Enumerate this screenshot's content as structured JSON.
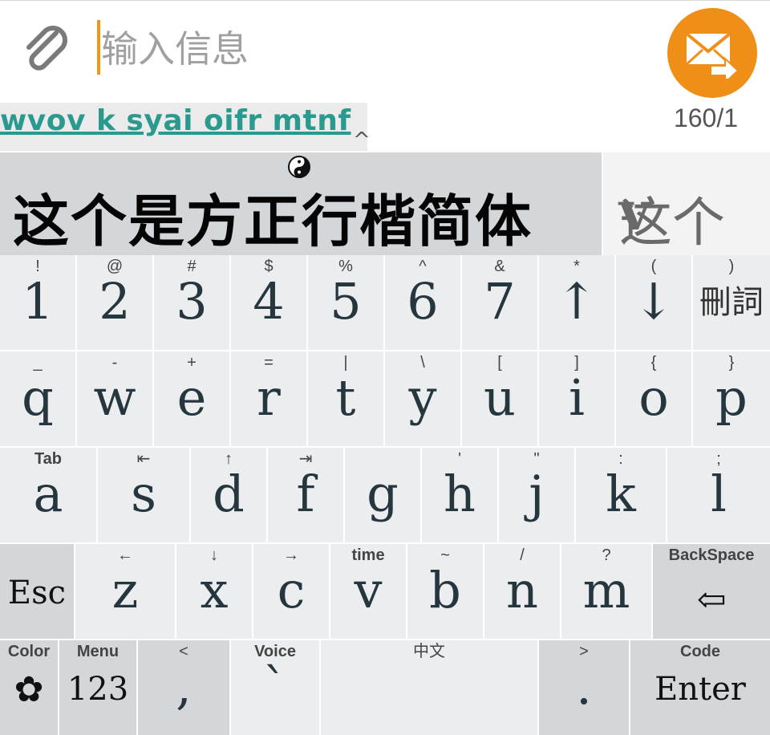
{
  "compose": {
    "placeholder": "输入信息",
    "counter": "160/1",
    "composing": "wvov k syai oifr mtnf",
    "caret_mark": "^"
  },
  "candidates": {
    "main": "这个是方正行楷简体",
    "next": "这个",
    "expand": "v"
  },
  "colors": {
    "accent": "#ef8f17",
    "composing_text": "#2a9a8f",
    "key_bg": "#ebedef",
    "function_key_bg": "#d4d7da"
  },
  "keyboard": {
    "row1": [
      {
        "sub": "!",
        "main": "1"
      },
      {
        "sub": "@",
        "main": "2"
      },
      {
        "sub": "#",
        "main": "3"
      },
      {
        "sub": "$",
        "main": "4"
      },
      {
        "sub": "%",
        "main": "5"
      },
      {
        "sub": "^",
        "main": "6"
      },
      {
        "sub": "&",
        "main": "7"
      },
      {
        "sub": "*",
        "main": "↑"
      },
      {
        "sub": "(",
        "main": "↓"
      },
      {
        "sub": ")",
        "main": "刪詞"
      }
    ],
    "row2": [
      {
        "sub": "_",
        "main": "q"
      },
      {
        "sub": "-",
        "main": "w"
      },
      {
        "sub": "+",
        "main": "e"
      },
      {
        "sub": "=",
        "main": "r"
      },
      {
        "sub": "|",
        "main": "t"
      },
      {
        "sub": "\\",
        "main": "y"
      },
      {
        "sub": "[",
        "main": "u"
      },
      {
        "sub": "]",
        "main": "i"
      },
      {
        "sub": "{",
        "main": "o"
      },
      {
        "sub": "}",
        "main": "p"
      }
    ],
    "row3": [
      {
        "sub": "Tab",
        "main": "a"
      },
      {
        "sub": "⇤",
        "main": "s"
      },
      {
        "sub": "↑",
        "main": "d"
      },
      {
        "sub": "⇥",
        "main": "f"
      },
      {
        "sub": "",
        "main": "g"
      },
      {
        "sub": "'",
        "main": "h"
      },
      {
        "sub": "\"",
        "main": "j"
      },
      {
        "sub": ":",
        "main": "k"
      },
      {
        "sub": ";",
        "main": "l"
      }
    ],
    "row4": [
      {
        "sub": "",
        "main": "Esc"
      },
      {
        "sub": "←",
        "main": "z"
      },
      {
        "sub": "↓",
        "main": "x"
      },
      {
        "sub": "→",
        "main": "c"
      },
      {
        "sub": "time",
        "main": "v"
      },
      {
        "sub": "~",
        "main": "b"
      },
      {
        "sub": "/",
        "main": "n"
      },
      {
        "sub": "?",
        "main": "m"
      },
      {
        "sub": "BackSpace",
        "main": "⇦"
      }
    ],
    "row5": [
      {
        "sub": "Color",
        "main": "✿"
      },
      {
        "sub": "Menu",
        "main": "123"
      },
      {
        "sub": "<",
        "main": ","
      },
      {
        "sub": "Voice",
        "main": "`"
      },
      {
        "sub": "中文",
        "main": ""
      },
      {
        "sub": ">",
        "main": "."
      },
      {
        "sub": "Code",
        "main": "Enter"
      }
    ]
  }
}
